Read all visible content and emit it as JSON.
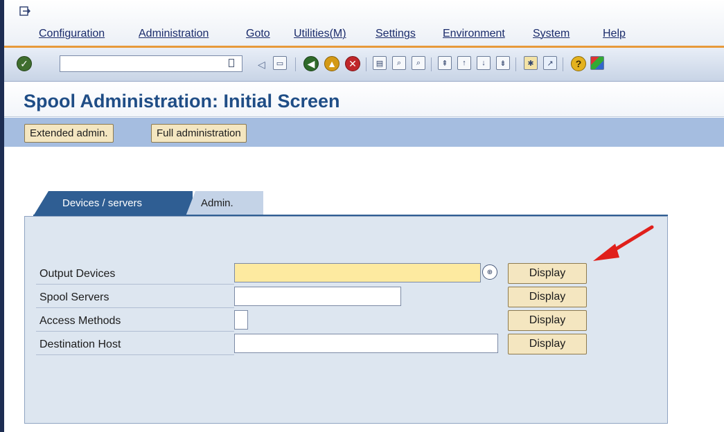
{
  "menu": {
    "items": [
      "Configuration",
      "Administration",
      "Goto",
      "Utilities(M)",
      "Settings",
      "Environment",
      "System",
      "Help"
    ]
  },
  "toolbar": {
    "command_field_value": "",
    "icons": [
      "enter-icon",
      "back-arrow-icon",
      "save-icon",
      "back-icon",
      "exit-icon",
      "cancel-icon",
      "print-icon",
      "find-icon",
      "find-next-icon",
      "first-page-icon",
      "previous-page-icon",
      "next-page-icon",
      "last-page-icon",
      "create-session-icon",
      "shortcut-icon",
      "help-icon",
      "customize-layout-icon"
    ]
  },
  "page": {
    "title": "Spool Administration: Initial Screen"
  },
  "app_toolbar": {
    "extended_admin_label": "Extended admin.",
    "full_admin_label": "Full administration"
  },
  "tabs": [
    {
      "label": "Devices / servers",
      "active": true
    },
    {
      "label": "Admin.",
      "active": false
    }
  ],
  "form": {
    "rows": [
      {
        "label": "Output Devices",
        "value": "",
        "button": "Display"
      },
      {
        "label": "Spool Servers",
        "value": "",
        "button": "Display"
      },
      {
        "label": "Access Methods",
        "value": "",
        "button": "Display"
      },
      {
        "label": "Destination Host",
        "value": "",
        "button": "Display"
      }
    ]
  },
  "colors": {
    "title": "#1f4d86",
    "app_toolbar": "#a5bde0",
    "button": "#f4e6c0",
    "required_field": "#fdeaa0",
    "tab_active": "#2f5e93",
    "annotation_arrow": "#e0201b"
  }
}
